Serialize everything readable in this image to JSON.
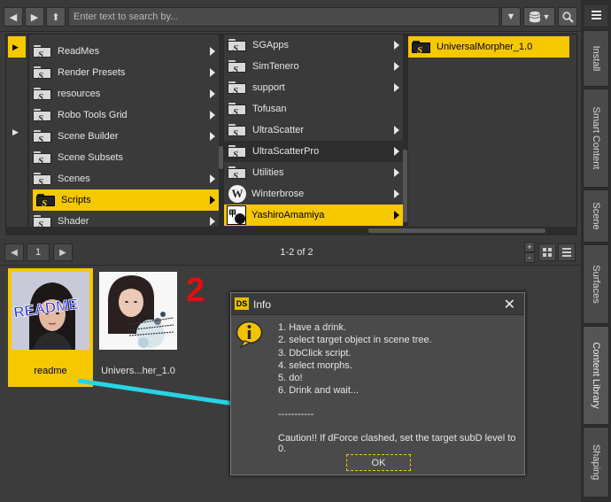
{
  "toolbar": {
    "back": "◀",
    "forward": "▶",
    "up": "⬆",
    "search_placeholder": "Enter text to search by...",
    "dropdown": "▼",
    "db_menu": "▼",
    "search_icon": "search-icon"
  },
  "tree": {
    "col0": {
      "arrow_top": "▶",
      "arrow_mid": "▶"
    },
    "col1": [
      {
        "label": "ReadMes"
      },
      {
        "label": "Render Presets"
      },
      {
        "label": "resources"
      },
      {
        "label": "Robo Tools Grid"
      },
      {
        "label": "Scene Builder"
      },
      {
        "label": "Scene Subsets"
      },
      {
        "label": "Scenes"
      },
      {
        "label": "Scripts"
      },
      {
        "label": "Shader"
      }
    ],
    "col2": [
      {
        "label": "SGApps"
      },
      {
        "label": "SimTenero"
      },
      {
        "label": "support"
      },
      {
        "label": "Tofusan"
      },
      {
        "label": "UltraScatter"
      },
      {
        "label": "UltraScatterPro"
      },
      {
        "label": "Utilities"
      },
      {
        "label": "Winterbrose"
      },
      {
        "label": "YashiroAmamiya"
      }
    ],
    "col3": [
      {
        "label": "UniversalMorpher_1.0"
      }
    ]
  },
  "controls": {
    "prev": "◀",
    "page": "1",
    "next": "▶",
    "count": "1-2 of 2",
    "plus": "+",
    "minus": "-"
  },
  "thumbs": [
    {
      "label": "readme",
      "art_text": "README"
    },
    {
      "label": "Univers...her_1.0"
    }
  ],
  "annotation": "2",
  "dialog": {
    "logo": "DS",
    "title": "Info",
    "close": "✕",
    "lines": [
      "1. Have a drink.",
      "2. select target object in scene tree.",
      "3. DbClick script.",
      "4. select morphs.",
      "5. do!",
      "6. Drink and wait..."
    ],
    "separator": "-----------",
    "caution": "Caution!! If dForce clashed, set the target subD level to 0.",
    "ok": "OK"
  },
  "sidebar": {
    "tabs": [
      {
        "label": "Install"
      },
      {
        "label": "Smart Content"
      },
      {
        "label": "Scene"
      },
      {
        "label": "Surfaces"
      },
      {
        "label": "Content Library"
      },
      {
        "label": "Shaping"
      }
    ]
  },
  "colors": {
    "selection": "#f5c800",
    "panel": "#3a3a3a",
    "annotation_red": "#e01010",
    "arrow_cyan": "#27d4e6"
  }
}
